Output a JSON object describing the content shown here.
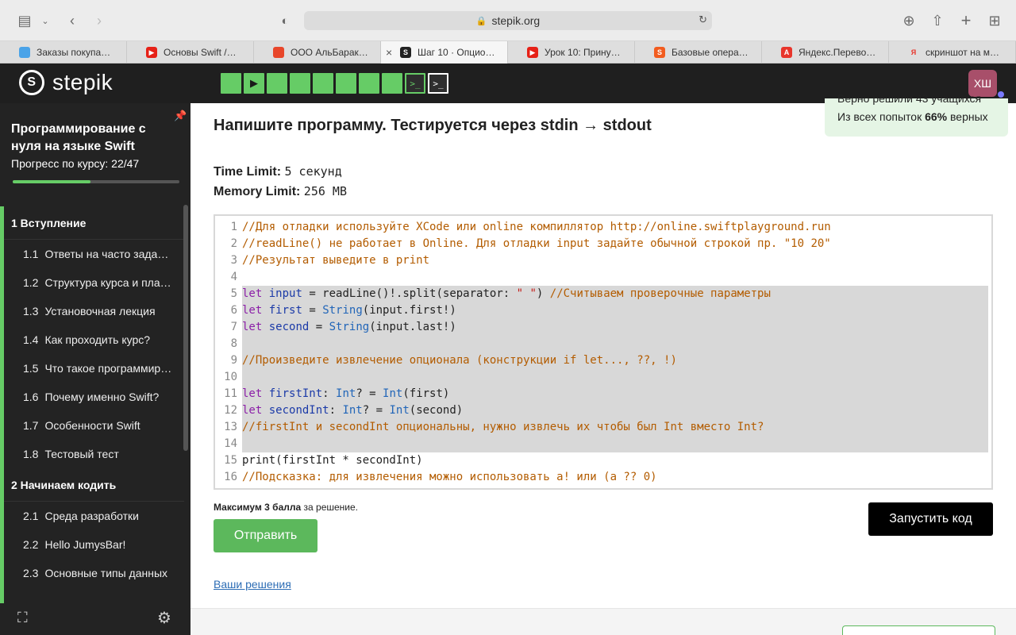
{
  "browser": {
    "url": "stepik.org",
    "tabs": [
      {
        "label": "Заказы покупа…",
        "fav_color": "#4aa3e8",
        "fav_text": "",
        "active": false
      },
      {
        "label": "Основы Swift /…",
        "fav_color": "#e62117",
        "fav_text": "▶",
        "active": false
      },
      {
        "label": "ООО АльБарак…",
        "fav_color": "#e8462a",
        "fav_text": "",
        "active": false
      },
      {
        "label": "Шаг 10 · Опцио…",
        "fav_color": "#222222",
        "fav_text": "S",
        "active": true
      },
      {
        "label": "Урок 10: Прину…",
        "fav_color": "#e62117",
        "fav_text": "▶",
        "active": false
      },
      {
        "label": "Базовые опера…",
        "fav_color": "#f25c1f",
        "fav_text": "S",
        "active": false
      },
      {
        "label": "Яндекс.Перево…",
        "fav_color": "#e8352b",
        "fav_text": "A",
        "active": false
      },
      {
        "label": "скриншот на м…",
        "fav_color": "#ffffff",
        "fav_text": "Я",
        "active": false
      }
    ]
  },
  "header": {
    "logo_text": "stepik",
    "avatar_initials": "ХШ",
    "step_count_done": 8
  },
  "sidebar": {
    "course_title": "Программирование с нуля на языке Swift",
    "progress_label": "Прогресс по курсу:",
    "progress_value": "22/47",
    "progress_fraction": 0.468,
    "modules": [
      {
        "title": "1  Вступление",
        "lessons": [
          {
            "num": "1.1",
            "label": "Ответы на часто зада…"
          },
          {
            "num": "1.2",
            "label": "Структура курса и пла…"
          },
          {
            "num": "1.3",
            "label": "Установочная лекция"
          },
          {
            "num": "1.4",
            "label": "Как проходить курс?"
          },
          {
            "num": "1.5",
            "label": "Что такое программир…"
          },
          {
            "num": "1.6",
            "label": "Почему именно Swift?"
          },
          {
            "num": "1.7",
            "label": "Особенности Swift"
          },
          {
            "num": "1.8",
            "label": "Тестовый тест"
          }
        ]
      },
      {
        "title": "2  Начинаем кодить",
        "lessons": [
          {
            "num": "2.1",
            "label": "Среда разработки"
          },
          {
            "num": "2.2",
            "label": "Hello JumysBar!"
          },
          {
            "num": "2.3",
            "label": "Основные типы данных"
          }
        ]
      }
    ]
  },
  "main": {
    "heading": "Напишите программу. Тестируется через stdin → stdout",
    "stats_clipped": "Верно решили 43 учащихся",
    "stats_prefix": "Из всех попыток ",
    "stats_percent": "66%",
    "stats_suffix": " верных",
    "time_limit_label": "Time Limit:",
    "time_limit_value": "5 секунд",
    "memory_limit_label": "Memory Limit:",
    "memory_limit_value": "256 MB",
    "code_lines": [
      {
        "n": "1",
        "sel": false,
        "tokens": [
          [
            "c",
            "//Для отладки используйте XCode или online компиллятор http://online.swiftplayground.run"
          ]
        ]
      },
      {
        "n": "2",
        "sel": false,
        "tokens": [
          [
            "c",
            "//readLine() не работает в Online. Для отладки input задайте обычной строкой пр. \"10 20\""
          ]
        ]
      },
      {
        "n": "3",
        "sel": false,
        "tokens": [
          [
            "c",
            "//Результат выведите в print"
          ]
        ]
      },
      {
        "n": "4",
        "sel": false,
        "tokens": []
      },
      {
        "n": "5",
        "sel": true,
        "tokens": [
          [
            "k",
            "let"
          ],
          [
            "p",
            " "
          ],
          [
            "v",
            "input"
          ],
          [
            "p",
            " = readLine()!.split(separator: "
          ],
          [
            "s",
            "\" \""
          ],
          [
            "p",
            ") "
          ],
          [
            "c",
            "//Считываем проверочные параметры"
          ]
        ]
      },
      {
        "n": "6",
        "sel": true,
        "tokens": [
          [
            "k",
            "let"
          ],
          [
            "p",
            " "
          ],
          [
            "v",
            "first"
          ],
          [
            "p",
            " = "
          ],
          [
            "t",
            "String"
          ],
          [
            "p",
            "(input.first!)"
          ]
        ]
      },
      {
        "n": "7",
        "sel": true,
        "tokens": [
          [
            "k",
            "let"
          ],
          [
            "p",
            " "
          ],
          [
            "v",
            "second"
          ],
          [
            "p",
            " = "
          ],
          [
            "t",
            "String"
          ],
          [
            "p",
            "(input.last!)"
          ]
        ]
      },
      {
        "n": "8",
        "sel": true,
        "tokens": []
      },
      {
        "n": "9",
        "sel": true,
        "tokens": [
          [
            "c",
            "//Произведите извлечение опционала (конструкции if let..., ??, !)"
          ]
        ]
      },
      {
        "n": "10",
        "sel": true,
        "tokens": []
      },
      {
        "n": "11",
        "sel": true,
        "tokens": [
          [
            "k",
            "let"
          ],
          [
            "p",
            " "
          ],
          [
            "v",
            "firstInt"
          ],
          [
            "p",
            ": "
          ],
          [
            "t",
            "Int"
          ],
          [
            "p",
            "? = "
          ],
          [
            "t",
            "Int"
          ],
          [
            "p",
            "(first)"
          ]
        ]
      },
      {
        "n": "12",
        "sel": true,
        "tokens": [
          [
            "k",
            "let"
          ],
          [
            "p",
            " "
          ],
          [
            "v",
            "secondInt"
          ],
          [
            "p",
            ": "
          ],
          [
            "t",
            "Int"
          ],
          [
            "p",
            "? = "
          ],
          [
            "t",
            "Int"
          ],
          [
            "p",
            "(second)"
          ]
        ]
      },
      {
        "n": "13",
        "sel": true,
        "tokens": [
          [
            "c",
            "//firstInt и secondInt опциональны, нужно извлечь их чтобы был Int вместо Int?"
          ]
        ]
      },
      {
        "n": "14",
        "sel": true,
        "tokens": []
      },
      {
        "n": "15",
        "sel": false,
        "tokens": [
          [
            "p",
            "print(firstInt * secondInt)"
          ]
        ]
      },
      {
        "n": "16",
        "sel": false,
        "tokens": [
          [
            "c",
            "//Подсказка: для извлечения можно использовать a! или (a ?? 0)"
          ]
        ]
      }
    ],
    "max_bold": "Максимум 3 балла",
    "max_rest": " за решение.",
    "submit_label": "Отправить",
    "run_label": "Запустить код",
    "solutions_link": "Ваши решения"
  }
}
